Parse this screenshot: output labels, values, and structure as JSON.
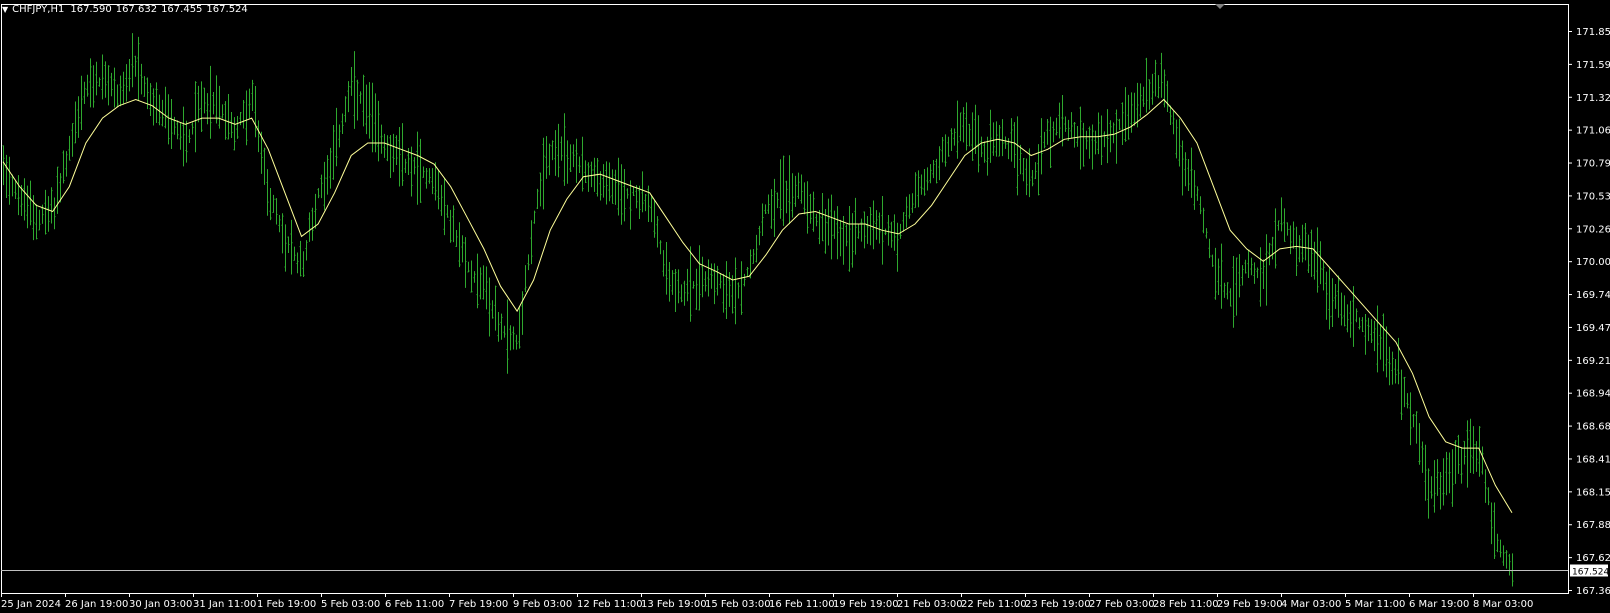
{
  "header": {
    "symbol": "CHFJPY,H1",
    "open": "167.590",
    "high": "167.632",
    "low": "167.455",
    "close": "167.524"
  },
  "colors": {
    "background": "#000000",
    "bars": "#2ea82e",
    "moving_average": "#ffff99",
    "axis": "#ffffff",
    "bid_line": "#c0c0c0",
    "price_tag_bg": "#ffffff",
    "price_tag_text": "#000000"
  },
  "chart_data": {
    "type": "line",
    "title": "CHFJPY,H1",
    "description_style": "OHLC bar chart (H1) with moving average overlay",
    "y_ticks": [
      "171.850",
      "171.590",
      "171.325",
      "171.060",
      "170.795",
      "170.530",
      "170.265",
      "170.000",
      "169.740",
      "169.475",
      "169.210",
      "168.945",
      "168.680",
      "168.415",
      "168.150",
      "167.885",
      "167.625",
      "167.360"
    ],
    "x_ticks": [
      "25 Jan 2024",
      "26 Jan 19:00",
      "30 Jan 03:00",
      "31 Jan 11:00",
      "1 Feb 19:00",
      "5 Feb 03:00",
      "6 Feb 11:00",
      "7 Feb 19:00",
      "9 Feb 03:00",
      "12 Feb 11:00",
      "13 Feb 19:00",
      "15 Feb 03:00",
      "16 Feb 11:00",
      "19 Feb 19:00",
      "21 Feb 03:00",
      "22 Feb 11:00",
      "23 Feb 19:00",
      "27 Feb 03:00",
      "28 Feb 11:00",
      "29 Feb 19:00",
      "4 Mar 03:00",
      "5 Mar 11:00",
      "6 Mar 19:00",
      "8 Mar 03:00"
    ],
    "ylim": [
      167.36,
      171.85
    ],
    "current_price": "167.524",
    "current_price_value": 167.524,
    "series": [
      {
        "kind": "close",
        "values": [
          170.8,
          170.5,
          170.35,
          170.4,
          170.9,
          171.4,
          171.45,
          171.35,
          171.55,
          171.25,
          171.15,
          170.95,
          171.3,
          171.25,
          171.05,
          171.3,
          170.55,
          170.15,
          169.95,
          170.55,
          170.9,
          171.4,
          171.2,
          170.95,
          170.8,
          170.75,
          170.65,
          170.3,
          169.95,
          169.8,
          169.45,
          169.35,
          170.35,
          170.9,
          170.85,
          170.75,
          170.65,
          170.55,
          170.55,
          170.45,
          169.9,
          169.75,
          169.85,
          169.9,
          169.7,
          169.95,
          170.45,
          170.55,
          170.6,
          170.35,
          170.25,
          170.2,
          170.3,
          170.25,
          170.2,
          170.55,
          170.7,
          170.95,
          171.1,
          170.9,
          170.95,
          170.9,
          170.65,
          171.05,
          171.1,
          171.0,
          170.95,
          171.05,
          171.2,
          171.35,
          171.45,
          170.8,
          170.55,
          169.95,
          169.7,
          170.0,
          169.85,
          170.35,
          170.15,
          170.05,
          169.75,
          169.6,
          169.5,
          169.35,
          169.15,
          168.75,
          168.15,
          168.25,
          168.45,
          168.5,
          167.75,
          167.52
        ]
      },
      {
        "kind": "moving_average",
        "values": [
          170.8,
          170.6,
          170.45,
          170.4,
          170.6,
          170.95,
          171.15,
          171.25,
          171.3,
          171.25,
          171.15,
          171.1,
          171.15,
          171.15,
          171.1,
          171.15,
          170.9,
          170.55,
          170.2,
          170.3,
          170.55,
          170.85,
          170.95,
          170.95,
          170.9,
          170.85,
          170.78,
          170.6,
          170.35,
          170.1,
          169.8,
          169.6,
          169.85,
          170.25,
          170.5,
          170.68,
          170.7,
          170.65,
          170.6,
          170.55,
          170.35,
          170.15,
          169.98,
          169.92,
          169.85,
          169.88,
          170.05,
          170.25,
          170.38,
          170.4,
          170.35,
          170.3,
          170.3,
          170.25,
          170.22,
          170.3,
          170.45,
          170.65,
          170.85,
          170.95,
          170.98,
          170.95,
          170.85,
          170.9,
          170.98,
          171.0,
          171.0,
          171.02,
          171.08,
          171.18,
          171.3,
          171.15,
          170.95,
          170.6,
          170.25,
          170.1,
          170.0,
          170.1,
          170.12,
          170.1,
          169.95,
          169.8,
          169.65,
          169.5,
          169.35,
          169.1,
          168.75,
          168.55,
          168.5,
          168.5,
          168.2,
          167.98
        ]
      }
    ]
  }
}
